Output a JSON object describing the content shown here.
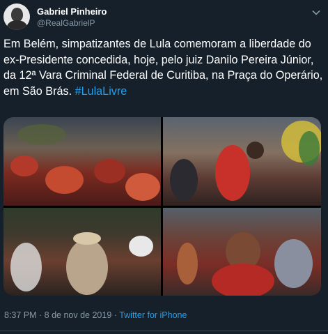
{
  "author": {
    "display_name": "Gabriel Pinheiro",
    "handle": "@RealGabrielP"
  },
  "tweet": {
    "text": "Em Belém, simpatizantes de Lula comemoram a liberdade do ex-Presidente concedida, hoje, pelo juiz Danilo Pereira Júnior, da 12ª Vara Criminal Federal de Curitiba, na Praça do Operário, em São Brás. ",
    "hashtag": "#LulaLivre"
  },
  "meta": {
    "time": "8:37 PM",
    "separator": " · ",
    "date": "8 de nov de 2019",
    "source": "Twitter for iPhone"
  },
  "colors": {
    "background": "#15202b",
    "link": "#1da1f2",
    "secondary_text": "#8899a6"
  },
  "icons": {
    "caret": "chevron-down-icon"
  }
}
